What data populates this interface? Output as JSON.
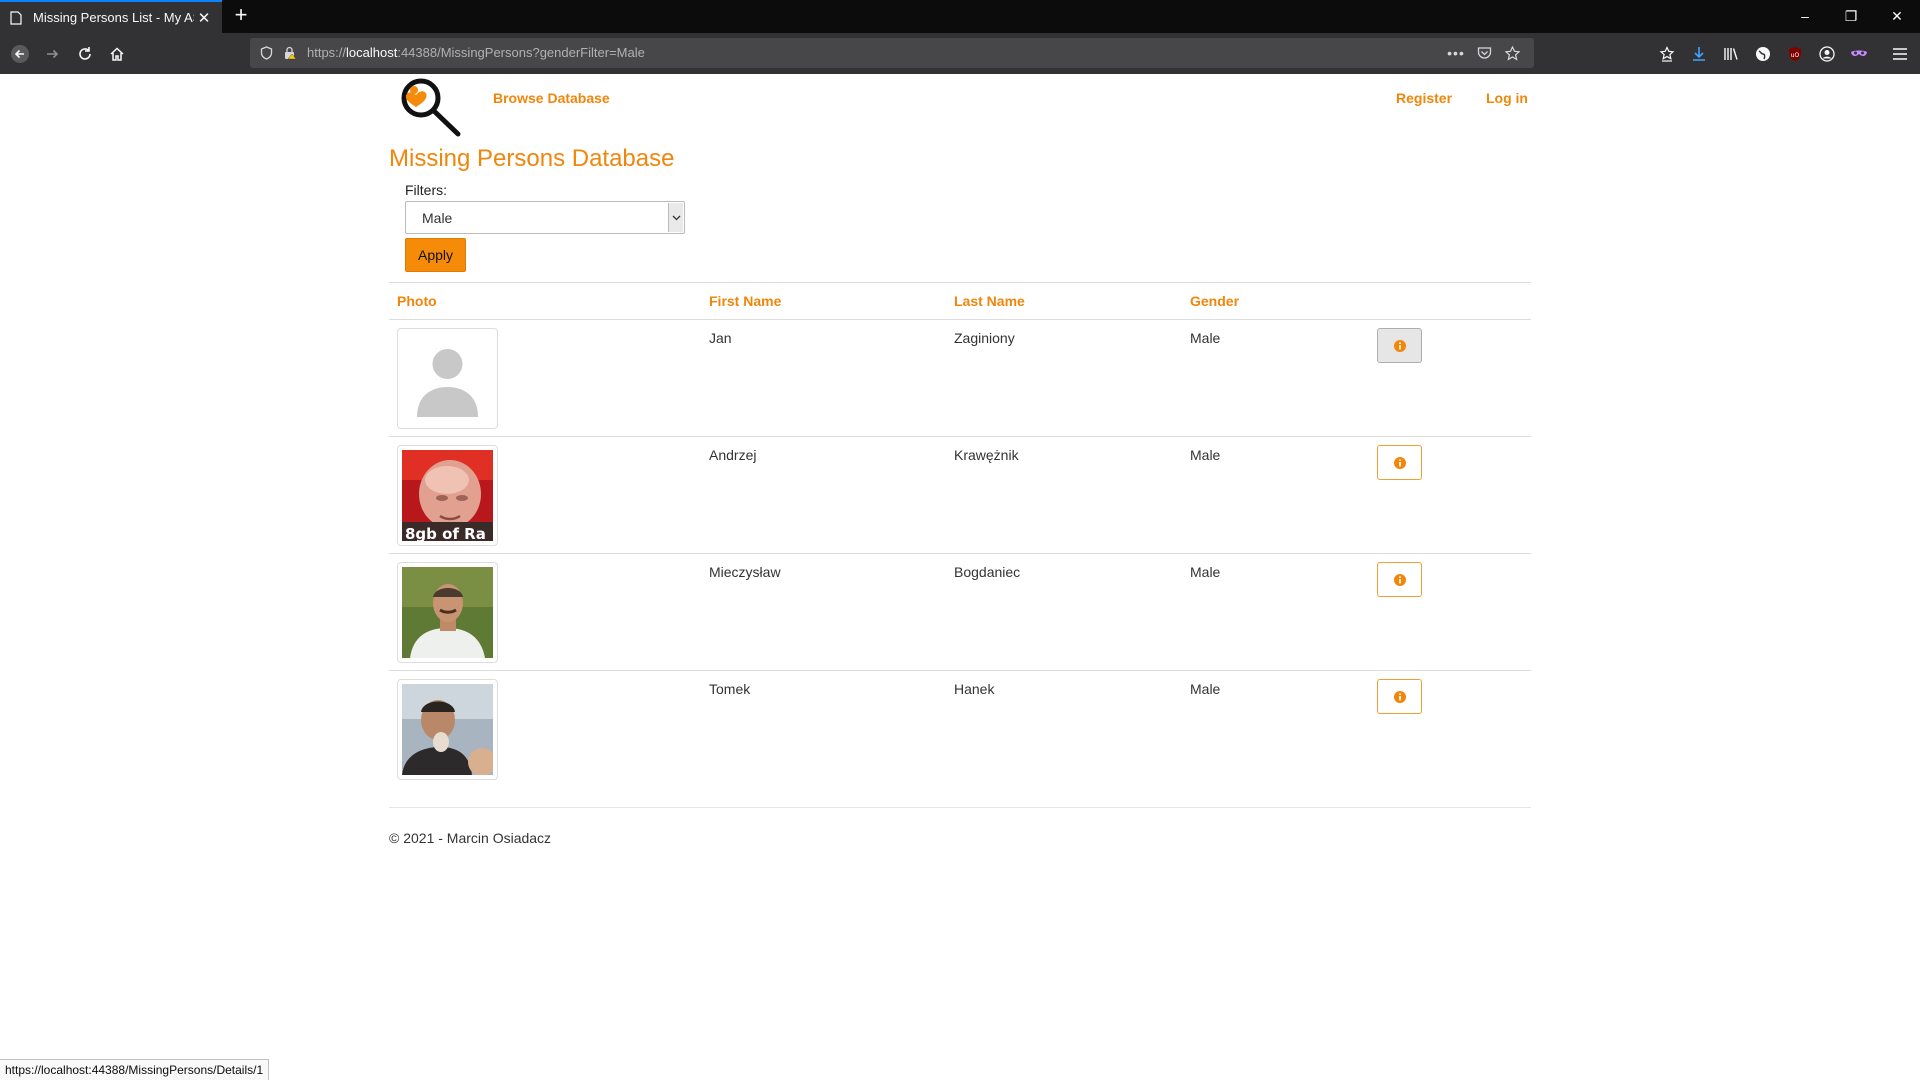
{
  "browser": {
    "tab_title": "Missing Persons List - My ASP.N",
    "url_prefix": "https://",
    "url_host": "localhost",
    "url_rest": ":44388/MissingPersons?genderFilter=Male",
    "status_url": "https://localhost:44388/MissingPersons/Details/1"
  },
  "nav": {
    "browse": "Browse Database",
    "register": "Register",
    "login": "Log in"
  },
  "page": {
    "title": "Missing Persons Database",
    "filters_label": "Filters:",
    "filter_value": "Male",
    "apply_label": "Apply"
  },
  "table": {
    "headers": [
      "Photo",
      "First Name",
      "Last Name",
      "Gender"
    ],
    "rows": [
      {
        "first": "Jan",
        "last": "Zaginiony",
        "gender": "Male",
        "photo": "placeholder-avatar"
      },
      {
        "first": "Andrzej",
        "last": "Krawężnik",
        "gender": "Male",
        "photo": "photo",
        "photo_caption": "8gb of Ra"
      },
      {
        "first": "Mieczysław",
        "last": "Bogdaniec",
        "gender": "Male",
        "photo": "photo"
      },
      {
        "first": "Tomek",
        "last": "Hanek",
        "gender": "Male",
        "photo": "photo"
      }
    ]
  },
  "footer": {
    "text": "© 2021 - Marcin Osiadacz"
  },
  "colors": {
    "accent": "#f0860b",
    "button": "#f68b0a"
  },
  "icons": [
    "page-icon",
    "close-icon",
    "plus-icon",
    "back-icon",
    "forward-icon",
    "reload-icon",
    "home-icon",
    "shield-icon",
    "lock-icon",
    "more-icon",
    "pocket-icon",
    "star-icon",
    "info-icon",
    "magnifier-logo-icon"
  ]
}
